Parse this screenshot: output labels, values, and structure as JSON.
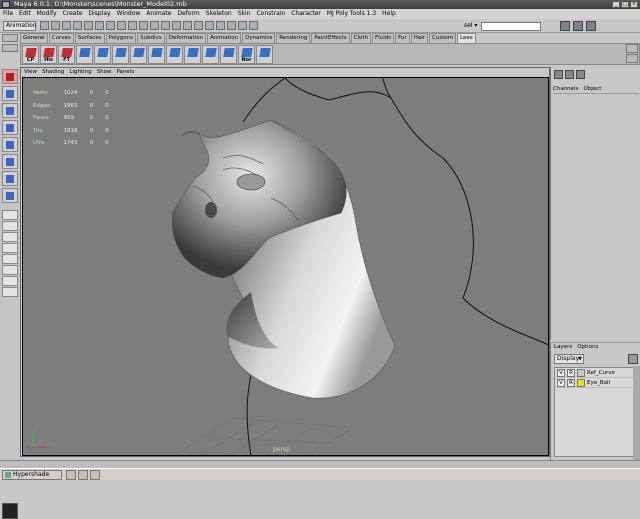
{
  "window": {
    "title": "Maya 6.0.1: D:\\Monster\\scenes\\Monster_Model02.mb"
  },
  "menubar": {
    "items": [
      "File",
      "Edit",
      "Modify",
      "Create",
      "Display",
      "Window",
      "Animate",
      "Deform",
      "Skeleton",
      "Skin",
      "Constrain",
      "Character",
      "MJ Poly Tools 1.3",
      "Help"
    ]
  },
  "status_line": {
    "mode": "Animation",
    "sel_label": "sel ▾",
    "sel_value": ""
  },
  "shelf": {
    "tabs": [
      "General",
      "Curves",
      "Surfaces",
      "Polygons",
      "Subdivs",
      "Deformation",
      "Animation",
      "Dynamics",
      "Rendering",
      "PaintEffects",
      "Cloth",
      "Fluids",
      "Fur",
      "Hair",
      "Custom",
      "Lees"
    ],
    "active_tab": "Lees",
    "buttons": [
      "CP",
      "His",
      "FT",
      "",
      "",
      "",
      "",
      "",
      "",
      "",
      "",
      "",
      "Nor",
      ""
    ]
  },
  "panel": {
    "menu": [
      "View",
      "Shading",
      "Lighting",
      "Show",
      "Panels"
    ],
    "camera": "persp",
    "hud": [
      {
        "label": "Verts:",
        "a": "1024",
        "b": "0",
        "c": "0"
      },
      {
        "label": "Edges:",
        "a": "1983",
        "b": "0",
        "c": "0"
      },
      {
        "label": "Faces:",
        "a": "959",
        "b": "0",
        "c": "0"
      },
      {
        "label": "Tris:",
        "a": "1918",
        "b": "0",
        "c": "0"
      },
      {
        "label": "UVs:",
        "a": "1743",
        "b": "0",
        "c": "0"
      }
    ],
    "axis": {
      "x": "x",
      "y": "y",
      "z": "z"
    }
  },
  "channel_box": {
    "menu": [
      "Channels",
      "Object"
    ]
  },
  "layers": {
    "menu": [
      "Layers",
      "Options"
    ],
    "display": "Display",
    "rows": [
      {
        "v": "V",
        "r": "R",
        "name": "Ref_Curve",
        "color": "#c8c8c8"
      },
      {
        "v": "V",
        "r": "R",
        "name": "Eye_Ball",
        "color": "#f0e000"
      }
    ]
  },
  "taskbar": {
    "item": "Hypershade"
  },
  "colors": {
    "viewport_bg": "#7d7d7d",
    "hud_label": "#b8e8b8"
  }
}
